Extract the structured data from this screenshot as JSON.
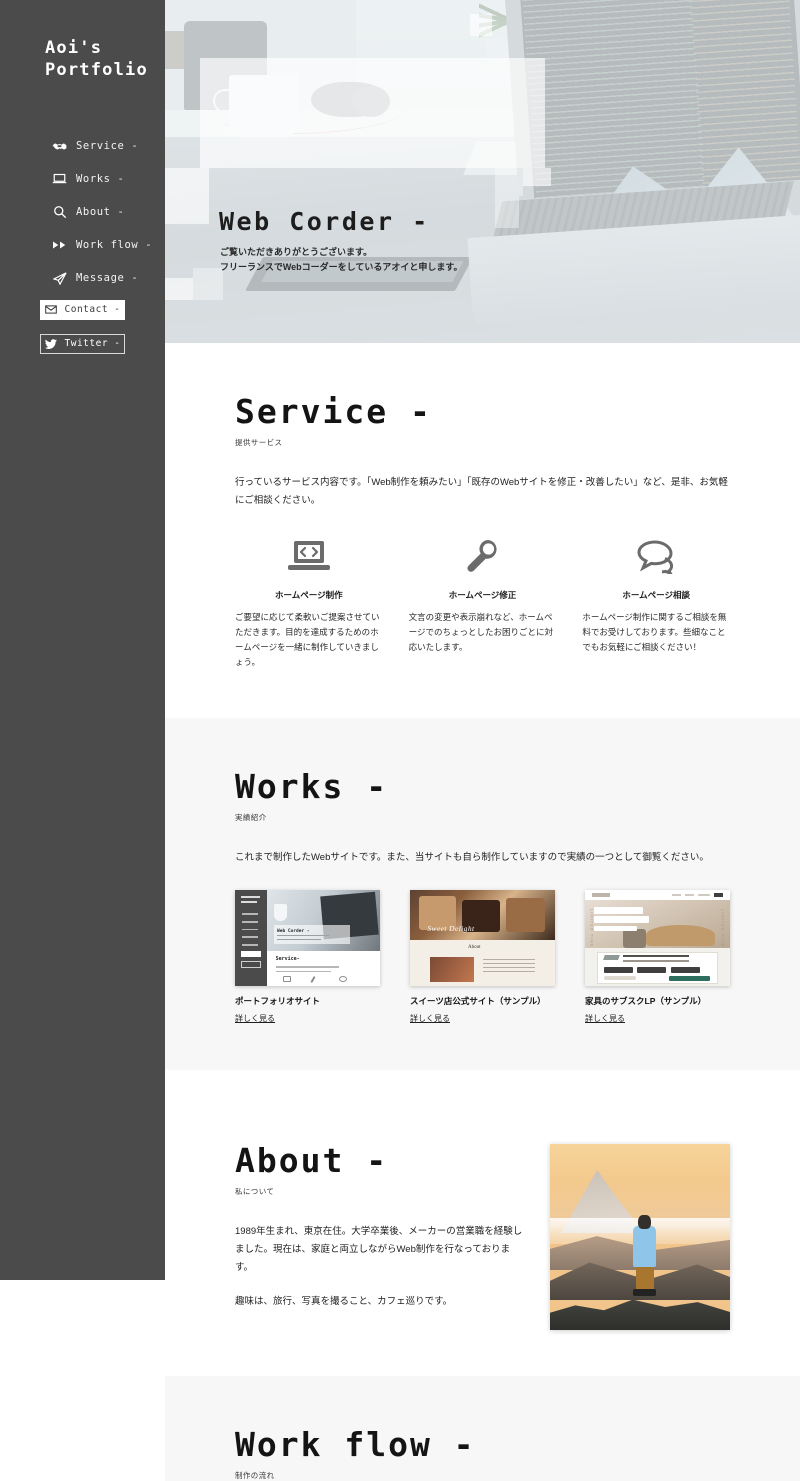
{
  "sidebar": {
    "brand_line1": "Aoi's",
    "brand_line2": "Portfolio",
    "nav": [
      {
        "label": "Service -",
        "icon": "handshake-icon"
      },
      {
        "label": "Works -",
        "icon": "laptop-icon"
      },
      {
        "label": "About -",
        "icon": "search-icon"
      },
      {
        "label": "Work flow -",
        "icon": "fast-forward-icon"
      },
      {
        "label": "Message -",
        "icon": "paper-plane-icon"
      }
    ],
    "buttons": [
      {
        "label": "Contact -",
        "icon": "mail-icon",
        "style": "light"
      },
      {
        "label": "Twitter -",
        "icon": "twitter-icon",
        "style": "dark"
      }
    ],
    "bg_color": "#4b4b4b"
  },
  "hero": {
    "title": "Web Corder -",
    "sub_line1": "ご覧いただきありがとうございます。",
    "sub_line2": "フリーランスでWebコーダーをしているアオイと申します。"
  },
  "service": {
    "title": "Service -",
    "subtitle": "提供サービス",
    "lead": "行っているサービス内容です。「Web制作を頼みたい」「既存のWebサイトを修正・改善したい」など、是非、お気軽にご相談ください。",
    "cards": [
      {
        "icon": "laptop-code-icon",
        "heading": "ホームページ制作",
        "body": "ご要望に応じて柔軟いご提案させていただきます。目的を達成するためのホームページを一緒に制作していきましょう。"
      },
      {
        "icon": "wrench-icon",
        "heading": "ホームページ修正",
        "body": "文言の変更や表示崩れなど、ホームページでのちょっとしたお困りごとに対応いたします。"
      },
      {
        "icon": "speech-bubbles-icon",
        "heading": "ホームページ相談",
        "body": "ホームページ制作に関するご相談を無料でお受けしております。些細なことでもお気軽にご相談ください！"
      }
    ]
  },
  "works": {
    "title": "Works -",
    "subtitle": "実績紹介",
    "lead": "これまで制作したWebサイトです。また、当サイトも自ら制作していますので実績の一つとして御覧ください。",
    "items": [
      {
        "title": "ポートフォリオサイト",
        "link": "詳しく見る",
        "thumb": "portfolio-site-thumbnail"
      },
      {
        "title": "スイーツ店公式サイト（サンプル）",
        "link": "詳しく見る",
        "thumb": "sweets-shop-thumbnail"
      },
      {
        "title": "家具のサブスクLP（サンプル）",
        "link": "詳しく見る",
        "thumb": "furniture-lp-thumbnail"
      }
    ],
    "thumb1_labels": {
      "hero_title": "Web Corder -",
      "section": "Service-"
    },
    "thumb2_labels": {
      "hero_title": "Sweet Delight",
      "section": "About"
    }
  },
  "about": {
    "title": "About -",
    "subtitle": "私について",
    "paragraph1": "1989年生まれ、東京在住。大学卒業後、メーカーの営業職を経験しました。現在は、家庭と両立しながらWeb制作を行なっております。",
    "paragraph2": "趣味は、旅行、写真を撮ること、カフェ巡りです。",
    "image_alt": "man-on-mountain-photo"
  },
  "workflow": {
    "title": "Work flow -",
    "subtitle": "制作の流れ"
  }
}
